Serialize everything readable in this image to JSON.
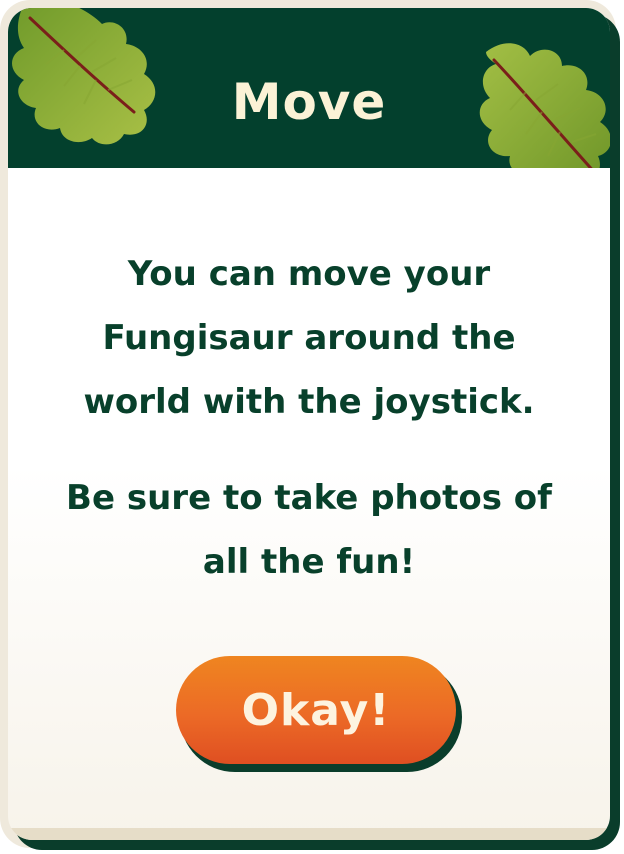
{
  "dialog": {
    "title": "Move",
    "message_line_1": "You can move your Fungisaur around the world with the joystick.",
    "message_line_2": "Be sure to take photos of all the fun!",
    "button_label": "Okay!"
  },
  "colors": {
    "header_green": "#03402d",
    "text_green": "#08402b",
    "title_cream": "#fbf2d6",
    "button_orange": "#ec6a26",
    "leaf_green": "#9ab83a",
    "leaf_vein": "#7a1f1a"
  },
  "icons": [
    "leaf-icon",
    "leaf-icon"
  ]
}
